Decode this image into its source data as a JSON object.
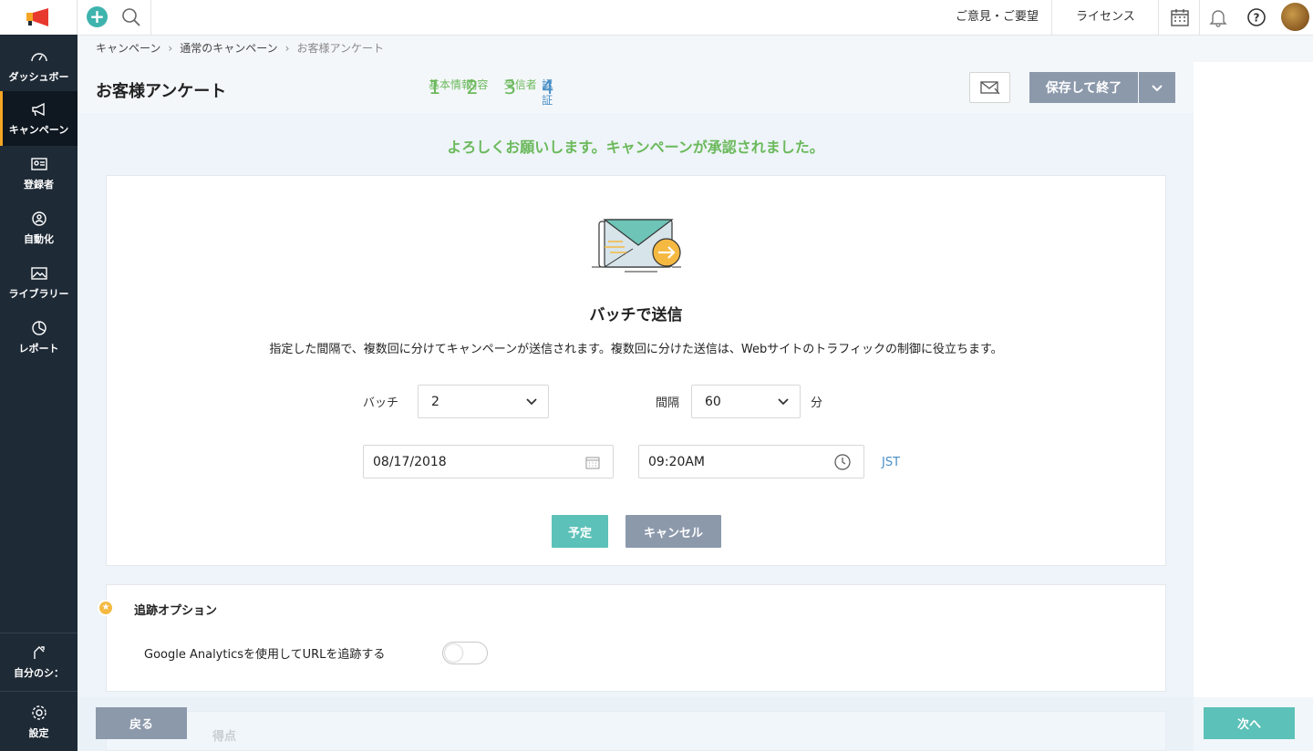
{
  "sidebar": {
    "items": [
      {
        "label": "ダッシュボー",
        "icon": "dashboard-icon"
      },
      {
        "label": "キャンペーン",
        "icon": "megaphone-icon"
      },
      {
        "label": "登録者",
        "icon": "contact-card-icon"
      },
      {
        "label": "自動化",
        "icon": "automation-icon"
      },
      {
        "label": "ライブラリー",
        "icon": "image-icon"
      },
      {
        "label": "レポート",
        "icon": "pie-chart-icon"
      }
    ],
    "bottom": [
      {
        "label": "自分のシ：",
        "icon": "bookmark-arrow-icon"
      },
      {
        "label": "設定",
        "icon": "gear-icon"
      }
    ]
  },
  "topbar": {
    "feedback": "ご意見・ご要望",
    "license": "ライセンス"
  },
  "breadcrumb": [
    "キャンペーン",
    "通常のキャンペーン",
    "お客様アンケート"
  ],
  "page_title": "お客様アンケート",
  "steps": [
    {
      "num": "1",
      "label": "基本情報"
    },
    {
      "num": "2",
      "label": "内容"
    },
    {
      "num": "3",
      "label": "受信者"
    },
    {
      "num": "4",
      "label": "認証"
    }
  ],
  "header_actions": {
    "save_label": "保存して終了"
  },
  "success_message": "よろしくお願いします。キャンペーンが承認されました。",
  "batch_card": {
    "title": "バッチで送信",
    "description": "指定した間隔で、複数回に分けてキャンペーンが送信されます。複数回に分けた送信は、Webサイトのトラフィックの制御に役立ちます。",
    "batch_label": "バッチ",
    "batch_value": "2",
    "interval_label": "間隔",
    "interval_value": "60",
    "interval_unit": "分",
    "date": "08/17/2018",
    "time": "09:20AM",
    "timezone": "JST",
    "schedule_label": "予定",
    "cancel_label": "キャンセル"
  },
  "tracking": {
    "title": "追跡オプション",
    "ga_label": "Google Analyticsを使用してURLを追跡する",
    "ga_enabled": false
  },
  "scoring": {
    "title": "得点"
  },
  "footer": {
    "back_label": "戻る",
    "next_label": "次へ"
  },
  "colors": {
    "accent_teal": "#5cc1b8",
    "success_green": "#6bb95c",
    "button_gray": "#8c99ab",
    "sidebar_dark": "#1e2a36"
  }
}
